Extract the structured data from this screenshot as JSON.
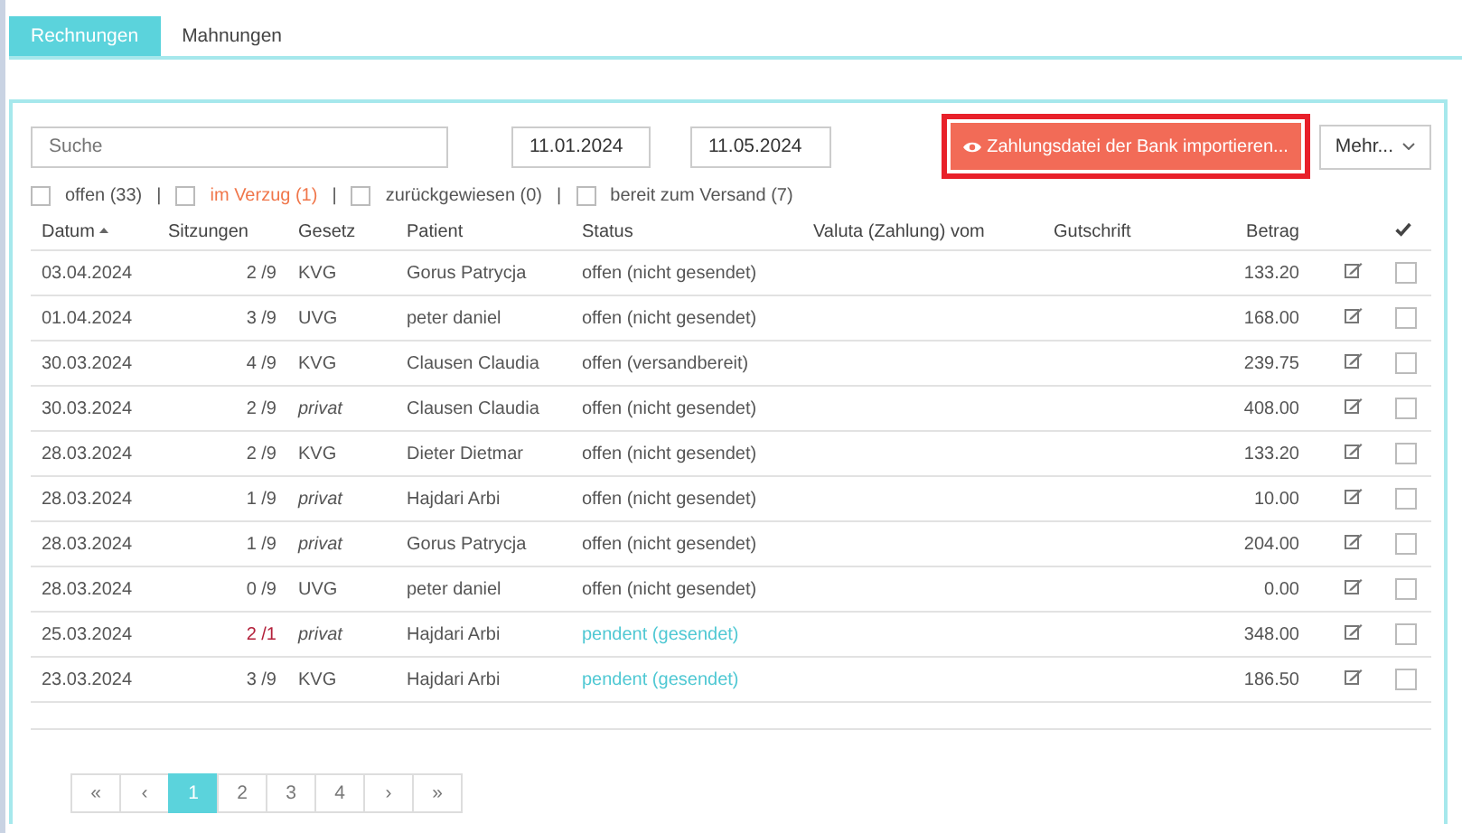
{
  "tabs": [
    {
      "label": "Rechnungen",
      "selected": true
    },
    {
      "label": "Mahnungen",
      "selected": false
    }
  ],
  "toolbar": {
    "search": {
      "placeholder": "Suche"
    },
    "date_from": "11.01.2024",
    "date_to": "11.05.2024",
    "import_button": "Zahlungsdatei der Bank importieren...",
    "more_button": "Mehr..."
  },
  "filters": [
    {
      "label": "offen (33)",
      "kind": "normal",
      "checked": false
    },
    {
      "label": "im Verzug (1)",
      "kind": "warning",
      "checked": false
    },
    {
      "label": "zurückgewiesen (0)",
      "kind": "normal",
      "checked": false
    },
    {
      "label": "bereit zum Versand (7)",
      "kind": "normal",
      "checked": false
    }
  ],
  "filter_separator": "|",
  "table": {
    "columns": [
      {
        "label": "Datum",
        "sorted": true
      },
      {
        "label": "Sitzungen",
        "sorted": false
      },
      {
        "label": "Gesetz",
        "sorted": false
      },
      {
        "label": "Patient",
        "sorted": false
      },
      {
        "label": "Status",
        "sorted": false
      },
      {
        "label": "Valuta (Zahlung) vom",
        "sorted": false
      },
      {
        "label": "Gutschrift",
        "sorted": false
      },
      {
        "label": "Betrag",
        "sorted": false
      }
    ],
    "rows": [
      {
        "date": "03.04.2024",
        "sessions": "2 /9",
        "overdue": false,
        "law": "KVG",
        "private": false,
        "patient": "Gorus Patrycja",
        "status": "offen (nicht gesendet)",
        "pending": false,
        "amount": "133.20",
        "checked": false
      },
      {
        "date": "01.04.2024",
        "sessions": "3 /9",
        "overdue": false,
        "law": "UVG",
        "private": false,
        "patient": "peter daniel",
        "status": "offen (nicht gesendet)",
        "pending": false,
        "amount": "168.00",
        "checked": false
      },
      {
        "date": "30.03.2024",
        "sessions": "4 /9",
        "overdue": false,
        "law": "KVG",
        "private": false,
        "patient": "Clausen Claudia",
        "status": "offen (versandbereit)",
        "pending": false,
        "amount": "239.75",
        "checked": false
      },
      {
        "date": "30.03.2024",
        "sessions": "2 /9",
        "overdue": false,
        "law": "privat",
        "private": true,
        "patient": "Clausen Claudia",
        "status": "offen (nicht gesendet)",
        "pending": false,
        "amount": "408.00",
        "checked": false
      },
      {
        "date": "28.03.2024",
        "sessions": "2 /9",
        "overdue": false,
        "law": "KVG",
        "private": false,
        "patient": "Dieter Dietmar",
        "status": "offen (nicht gesendet)",
        "pending": false,
        "amount": "133.20",
        "checked": false
      },
      {
        "date": "28.03.2024",
        "sessions": "1 /9",
        "overdue": false,
        "law": "privat",
        "private": true,
        "patient": "Hajdari Arbi",
        "status": "offen (nicht gesendet)",
        "pending": false,
        "amount": "10.00",
        "checked": false
      },
      {
        "date": "28.03.2024",
        "sessions": "1 /9",
        "overdue": false,
        "law": "privat",
        "private": true,
        "patient": "Gorus Patrycja",
        "status": "offen (nicht gesendet)",
        "pending": false,
        "amount": "204.00",
        "checked": false
      },
      {
        "date": "28.03.2024",
        "sessions": "0 /9",
        "overdue": false,
        "law": "UVG",
        "private": false,
        "patient": "peter daniel",
        "status": "offen (nicht gesendet)",
        "pending": false,
        "amount": "0.00",
        "checked": false
      },
      {
        "date": "25.03.2024",
        "sessions": "2 /1",
        "overdue": true,
        "law": "privat",
        "private": true,
        "patient": "Hajdari Arbi",
        "status": "pendent (gesendet)",
        "pending": true,
        "amount": "348.00",
        "checked": false
      },
      {
        "date": "23.03.2024",
        "sessions": "3 /9",
        "overdue": false,
        "law": "KVG",
        "private": false,
        "patient": "Hajdari Arbi",
        "status": "pendent (gesendet)",
        "pending": true,
        "amount": "186.50",
        "checked": false
      }
    ]
  },
  "pagination": [
    {
      "label": "«",
      "selected": false
    },
    {
      "label": "‹",
      "selected": false
    },
    {
      "label": "1",
      "selected": true
    },
    {
      "label": "2",
      "selected": false
    },
    {
      "label": "3",
      "selected": false
    },
    {
      "label": "4",
      "selected": false
    },
    {
      "label": "›",
      "selected": false
    },
    {
      "label": "»",
      "selected": false
    }
  ]
}
